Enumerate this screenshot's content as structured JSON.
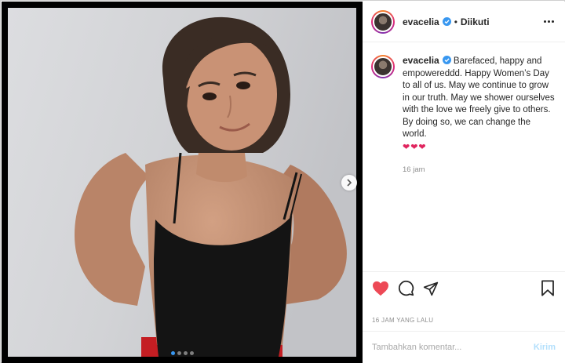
{
  "post": {
    "username": "evacelia",
    "verified": true,
    "follow_separator": "•",
    "follow_status": "Diikuti",
    "caption": "Barefaced, happy and empowereddd. Happy Women’s Day to all of us. May we continue to grow in our truth. May we shower ourselves with the love we freely give to others. By doing so, we can change the world.",
    "caption_hearts": "❤❤❤",
    "caption_time": "16 jam",
    "timestamp": "16 JAM YANG LALU",
    "liked": true,
    "carousel": {
      "slides": 4,
      "active_index": 0
    }
  },
  "comment": {
    "placeholder": "Tambahkan komentar...",
    "post_label": "Kirim"
  },
  "icons": {
    "verified": "verified-badge-icon",
    "more": "more-options-icon",
    "like": "heart-icon",
    "comment": "comment-icon",
    "share": "share-icon",
    "save": "bookmark-icon",
    "next": "chevron-right-icon"
  },
  "colors": {
    "like_red": "#ed4956",
    "verified_blue": "#3897f0",
    "post_button_disabled": "#b2dffc"
  }
}
